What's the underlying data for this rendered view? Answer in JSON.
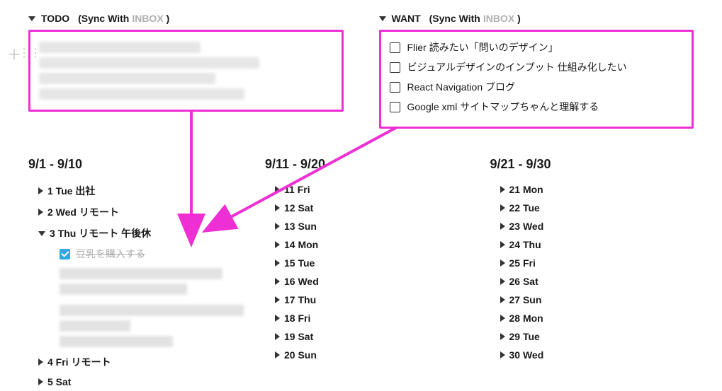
{
  "sections": {
    "todo": {
      "title_prefix": "TODO",
      "sync_prefix": "(Sync With ",
      "inbox": "INBOX",
      "sync_suffix": ")"
    },
    "want": {
      "title_prefix": "WANT",
      "sync_prefix": "(Sync With ",
      "inbox": "INBOX",
      "sync_suffix": ")",
      "items": [
        "Flier 読みたい「問いのデザイン」",
        "ビジュアルデザインのインプット 仕組み化したい",
        "React Navigation ブログ",
        "Google xml サイトマップちゃんと理解する"
      ]
    }
  },
  "add_glyph": "＋",
  "drag_glyph": "⋮⋮",
  "ranges": [
    {
      "title": "9/1 - 9/10",
      "days": [
        {
          "label": "1 Tue 出社",
          "expanded": false
        },
        {
          "label": "2 Wed リモート",
          "expanded": false
        },
        {
          "label": "3 Thu リモート 午後休",
          "expanded": true,
          "sub_done": "豆乳を購入する"
        },
        {
          "label": "4 Fri リモート",
          "expanded": false
        },
        {
          "label": "5 Sat",
          "expanded": false
        }
      ]
    },
    {
      "title": "9/11 - 9/20",
      "days": [
        {
          "label": "11 Fri"
        },
        {
          "label": "12 Sat"
        },
        {
          "label": "13 Sun"
        },
        {
          "label": "14 Mon"
        },
        {
          "label": "15 Tue"
        },
        {
          "label": "16 Wed"
        },
        {
          "label": "17 Thu"
        },
        {
          "label": "18 Fri"
        },
        {
          "label": "19 Sat"
        },
        {
          "label": "20 Sun"
        }
      ]
    },
    {
      "title": "9/21 - 9/30",
      "days": [
        {
          "label": "21 Mon"
        },
        {
          "label": "22 Tue"
        },
        {
          "label": "23 Wed"
        },
        {
          "label": "24 Thu"
        },
        {
          "label": "25 Fri"
        },
        {
          "label": "26 Sat"
        },
        {
          "label": "27 Sun"
        },
        {
          "label": "28 Mon"
        },
        {
          "label": "29 Tue"
        },
        {
          "label": "30 Wed"
        }
      ]
    }
  ]
}
